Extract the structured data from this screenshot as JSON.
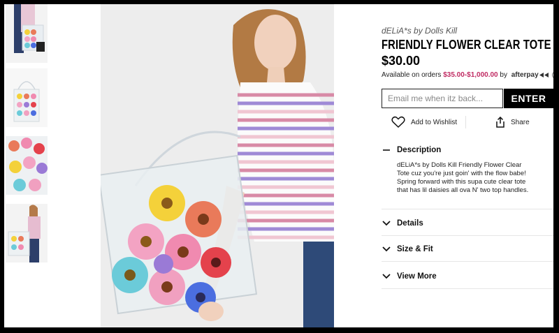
{
  "thumbnails": [
    {
      "name": "thumb-model-front"
    },
    {
      "name": "thumb-tote-flat"
    },
    {
      "name": "thumb-flowers-closeup"
    },
    {
      "name": "thumb-model-side"
    }
  ],
  "product": {
    "brand": "dELiA*s by Dolls Kill",
    "title": "FRIENDLY FLOWER CLEAR TOTE",
    "price": "$30.00"
  },
  "afterpay": {
    "prefix": "Available on orders",
    "range": "$35.00-$1,000.00",
    "by": "by",
    "logo": "afterpay",
    "info_icon": "?"
  },
  "restock": {
    "placeholder": "Email me when itz back...",
    "button_label": "ENTER"
  },
  "actions": {
    "wishlist_label": "Add to Wishlist",
    "share_label": "Share"
  },
  "accordion": [
    {
      "label": "Description",
      "expanded": true,
      "icon": "minus-icon",
      "body": "dELiA*s by Dolls Kill Friendly Flower Clear Tote cuz you're just goin' with the flow babe! Spring forward with this supa cute clear tote that has lil daisies all ova N' two top handles."
    },
    {
      "label": "Details",
      "expanded": false,
      "icon": "chevron-down-icon"
    },
    {
      "label": "Size & Fit",
      "expanded": false,
      "icon": "chevron-down-icon"
    },
    {
      "label": "View More",
      "expanded": false,
      "icon": "chevron-down-icon"
    }
  ],
  "colors": {
    "accent_price": "#c02b63",
    "button_bg": "#000000",
    "button_text": "#ffffff"
  }
}
